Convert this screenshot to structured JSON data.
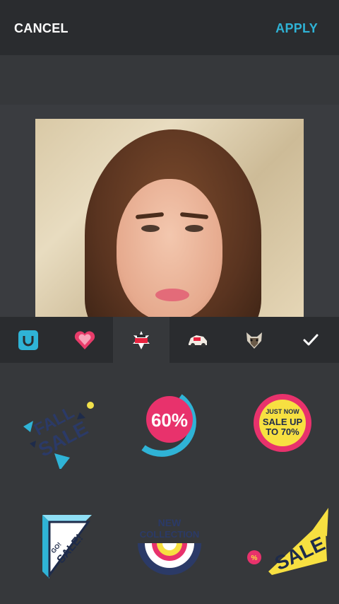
{
  "header": {
    "cancel_label": "CANCEL",
    "apply_label": "APPLY"
  },
  "colors": {
    "accent": "#2fb3d6",
    "bar": "#2a2c2f",
    "panel": "#36383b"
  },
  "tabs": [
    {
      "icon": "bag-icon",
      "active": false
    },
    {
      "icon": "heart-sticker-icon",
      "active": false
    },
    {
      "icon": "sale-sticker-icon",
      "active": true
    },
    {
      "icon": "car-sticker-icon",
      "active": false
    },
    {
      "icon": "dog-sticker-icon",
      "active": false
    },
    {
      "icon": "checkmark-icon",
      "active": false
    }
  ],
  "stickers": {
    "fall_sale": {
      "line1": "FALL",
      "line2": "SALE"
    },
    "percent": {
      "text": "60%"
    },
    "just_now": {
      "line1": "JUST NOW",
      "line2": "SALE UP",
      "line3": "TO 70%"
    },
    "go_sale": {
      "small": "GO!",
      "big": "SALE!"
    },
    "new_collection": {
      "line1": "NEW",
      "line2": "COLLECTION"
    },
    "sale_banner": {
      "text": "SALE",
      "badge": "%"
    }
  }
}
